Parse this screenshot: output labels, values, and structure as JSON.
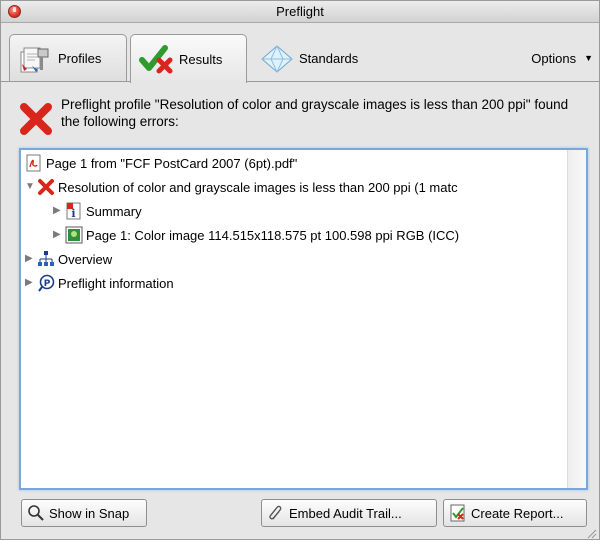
{
  "window": {
    "title": "Preflight"
  },
  "tabs": [
    {
      "label": "Profiles",
      "icon": "profiles-icon"
    },
    {
      "label": "Results",
      "icon": "checkmark-x-icon",
      "active": true
    },
    {
      "label": "Standards",
      "icon": "diamond-icon"
    }
  ],
  "options": {
    "label": "Options"
  },
  "message": {
    "text": "Preflight profile \"Resolution of color and grayscale images is less than 200 ppi\" found the following errors:"
  },
  "tree": {
    "items": [
      {
        "label": "Page 1 from \"FCF PostCard 2007 (6pt).pdf\"",
        "icon": "pdf-icon",
        "expander": ""
      },
      {
        "label": "Resolution of color and grayscale images is less than 200 ppi (1 matc",
        "icon": "error-x-icon",
        "expander": "▼"
      },
      {
        "label": "Summary",
        "icon": "info-icon",
        "expander": "▶"
      },
      {
        "label": "Page 1: Color image 114.515x118.575 pt 100.598 ppi RGB (ICC)",
        "icon": "image-icon",
        "expander": "▶"
      },
      {
        "label": "Overview",
        "icon": "hierarchy-icon",
        "expander": "▶"
      },
      {
        "label": "Preflight information",
        "icon": "preflight-info-icon",
        "expander": "▶"
      }
    ]
  },
  "buttons": {
    "show_in_snap": "Show in Snap",
    "embed_audit": "Embed Audit Trail...",
    "create_report": "Create Report..."
  },
  "colors": {
    "error_red": "#d9261c",
    "focus_blue": "#7aa7d8",
    "check_green": "#2e9b2e"
  }
}
